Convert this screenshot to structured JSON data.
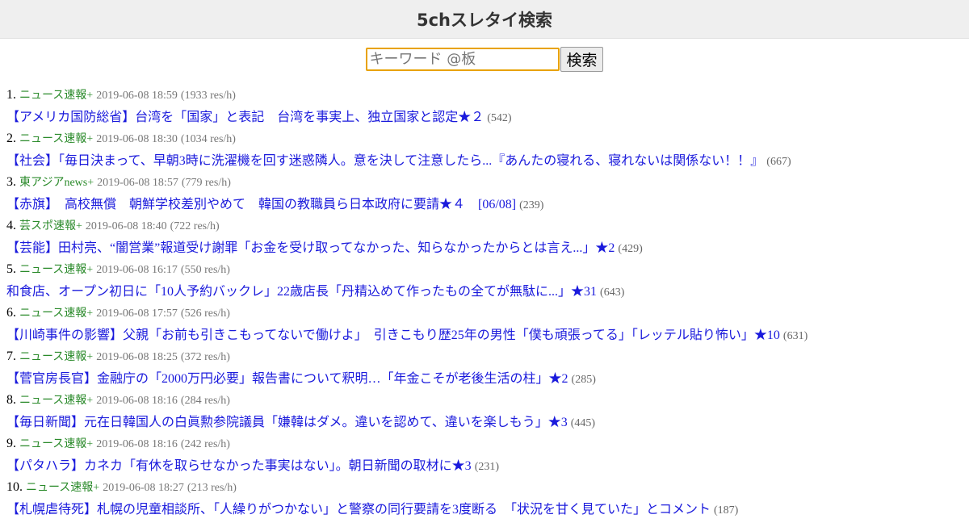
{
  "header": {
    "title": "5chスレタイ検索"
  },
  "search": {
    "placeholder": "キーワード @板",
    "button_label": "検索"
  },
  "results": [
    {
      "rank": "1.",
      "board": "ニュース速報+",
      "date": "2019-06-08 18:59",
      "speed": "(1933 res/h)",
      "title": "【アメリカ国防総省】台湾を「国家」と表記　台湾を事実上、独立国家と認定★２",
      "count": "(542)"
    },
    {
      "rank": "2.",
      "board": "ニュース速報+",
      "date": "2019-06-08 18:30",
      "speed": "(1034 res/h)",
      "title": "【社会】「毎日決まって、早朝3時に洗濯機を回す迷惑隣人。意を決して注意したら...『あんたの寝れる、寝れないは関係ない！！』",
      "count": "(667)"
    },
    {
      "rank": "3.",
      "board": "東アジアnews+",
      "date": "2019-06-08 18:57",
      "speed": "(779 res/h)",
      "title": "【赤旗】　高校無償　朝鮮学校差別やめて　韓国の教職員ら日本政府に要請★４　[06/08]",
      "count": "(239)"
    },
    {
      "rank": "4.",
      "board": "芸スポ速報+",
      "date": "2019-06-08 18:40",
      "speed": "(722 res/h)",
      "title": "【芸能】田村亮、“闇営業”報道受け謝罪「お金を受け取ってなかった、知らなかったからとは言え...」★2",
      "count": "(429)"
    },
    {
      "rank": "5.",
      "board": "ニュース速報+",
      "date": "2019-06-08 16:17",
      "speed": "(550 res/h)",
      "title": "和食店、オープン初日に「10人予約バックレ」22歳店長「丹精込めて作ったもの全てが無駄に...」★31",
      "count": "(643)"
    },
    {
      "rank": "6.",
      "board": "ニュース速報+",
      "date": "2019-06-08 17:57",
      "speed": "(526 res/h)",
      "title": "【川崎事件の影響】父親「お前も引きこもってないで働けよ」　引きこもり歴25年の男性「僕も頑張ってる」「レッテル貼り怖い」★10",
      "count": "(631)"
    },
    {
      "rank": "7.",
      "board": "ニュース速報+",
      "date": "2019-06-08 18:25",
      "speed": "(372 res/h)",
      "title": "【菅官房長官】金融庁の「2000万円必要」報告書について釈明…「年金こそが老後生活の柱」★2",
      "count": "(285)"
    },
    {
      "rank": "8.",
      "board": "ニュース速報+",
      "date": "2019-06-08 18:16",
      "speed": "(284 res/h)",
      "title": "【毎日新聞】元在日韓国人の白眞勲参院議員「嫌韓はダメ。違いを認めて、違いを楽しもう」★3",
      "count": "(445)"
    },
    {
      "rank": "9.",
      "board": "ニュース速報+",
      "date": "2019-06-08 18:16",
      "speed": "(242 res/h)",
      "title": "【パタハラ】カネカ「有休を取らせなかった事実はない」。朝日新聞の取材に★3",
      "count": "(231)"
    },
    {
      "rank": "10.",
      "board": "ニュース速報+",
      "date": "2019-06-08 18:27",
      "speed": "(213 res/h)",
      "title": "【札幌虐待死】札幌の児童相談所、「人繰りがつかない」と警察の同行要請を3度断る　「状況を甘く見ていた」とコメント",
      "count": "(187)"
    }
  ]
}
